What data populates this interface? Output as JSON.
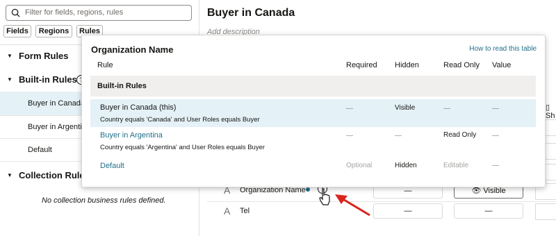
{
  "left": {
    "search_placeholder": "Filter for fields, regions, rules",
    "chips": [
      "Fields",
      "Regions",
      "Rules"
    ],
    "form_rules_label": "Form Rules",
    "builtin_rules_label": "Built-in Rules",
    "rules": [
      "Buyer in Canada",
      "Buyer in Argentin",
      "Default"
    ],
    "collection_rules_label": "Collection Rule",
    "collection_empty": "No collection business rules defined."
  },
  "main": {
    "title": "Buyer in Canada",
    "description_placeholder": "Add description",
    "fields": [
      {
        "name": "Organization Name",
        "required": "—",
        "state": "Visible"
      },
      {
        "name": "Tel",
        "required": "—",
        "state": "—"
      }
    ],
    "right_cut_label": "Sh"
  },
  "popup": {
    "title": "Organization Name",
    "help_link": "How to read this table",
    "columns": [
      "Rule",
      "Required",
      "Hidden",
      "Read Only",
      "Value"
    ],
    "group_label": "Built-in Rules",
    "rows": [
      {
        "name": "Buyer in Canada (this)",
        "desc": "Country equals 'Canada' and User Roles equals Buyer",
        "required": "—",
        "hidden": "Visible",
        "read_only": "—",
        "value": "—"
      },
      {
        "name": "Buyer in Argentina",
        "desc": "Country equals 'Argentina' and User Roles equals Buyer",
        "required": "—",
        "hidden": "—",
        "read_only": "Read Only",
        "value": "—"
      },
      {
        "name": "Default",
        "desc": "",
        "required": "Optional",
        "hidden": "Hidden",
        "read_only": "Editable",
        "value": "—"
      }
    ]
  },
  "colors": {
    "accent": "#1f6f8b",
    "selected_row": "#e4f1f7",
    "arrow": "#d9251c"
  }
}
